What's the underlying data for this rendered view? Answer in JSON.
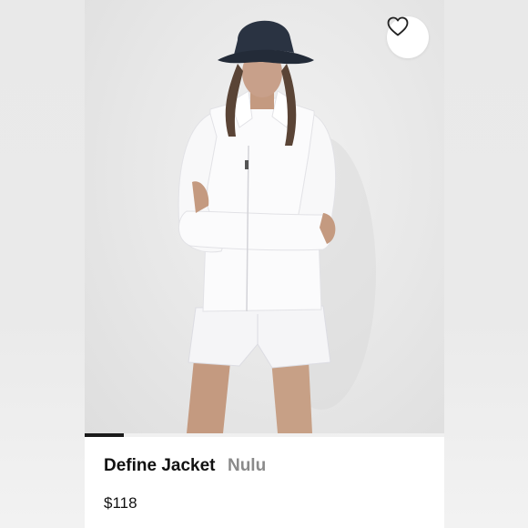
{
  "listing": {
    "name": "Define Jacket",
    "brand": "Nulu",
    "price": "$118"
  },
  "image_carousel": {
    "progress": 0.11
  },
  "icons": {
    "like": "heart-outline-icon"
  },
  "colors": {
    "text_primary": "#111111",
    "text_secondary": "#8a8a8a",
    "progress": "#1b1b1b"
  }
}
